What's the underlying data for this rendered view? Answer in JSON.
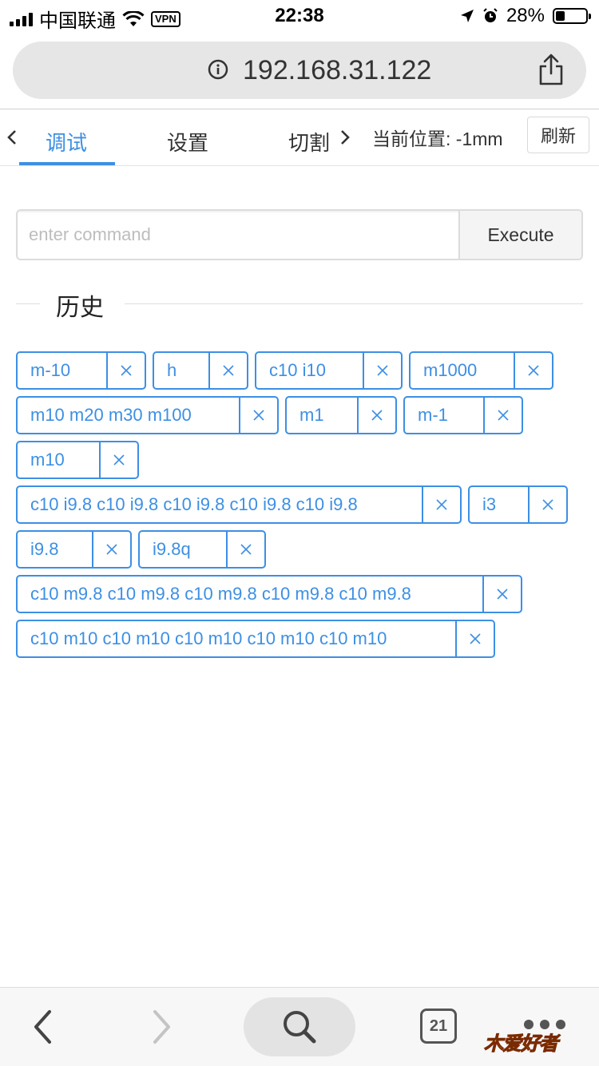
{
  "status_bar": {
    "carrier": "中国联通",
    "vpn": "VPN",
    "time": "22:38",
    "battery": "28%",
    "battery_level": 0.28
  },
  "address_bar": {
    "url": "192.168.31.122"
  },
  "tabs": {
    "items": [
      {
        "label": "调试",
        "active": true
      },
      {
        "label": "设置",
        "active": false
      },
      {
        "label": "切割",
        "active": false
      }
    ],
    "position_text": "当前位置: -1mm",
    "refresh_label": "刷新"
  },
  "command": {
    "placeholder": "enter command",
    "value": "",
    "execute_label": "Execute"
  },
  "history": {
    "title": "历史",
    "items": [
      "m-10",
      "h",
      "c10 i10",
      "m1000",
      "m10 m20 m30 m100",
      "m1",
      "m-1",
      "m10",
      "c10 i9.8 c10 i9.8 c10 i9.8 c10 i9.8 c10 i9.8",
      "i3",
      "i9.8",
      "i9.8q",
      "c10 m9.8 c10 m9.8 c10 m9.8 c10 m9.8 c10 m9.8",
      "c10 m10 c10 m10 c10 m10 c10 m10 c10 m10"
    ]
  },
  "bottom_bar": {
    "tab_count": "21",
    "logo_text": "爱好者"
  },
  "colors": {
    "accent": "#3d8fe4",
    "border": "#dcdcdc",
    "chrome_bg": "#e6e6e6"
  }
}
